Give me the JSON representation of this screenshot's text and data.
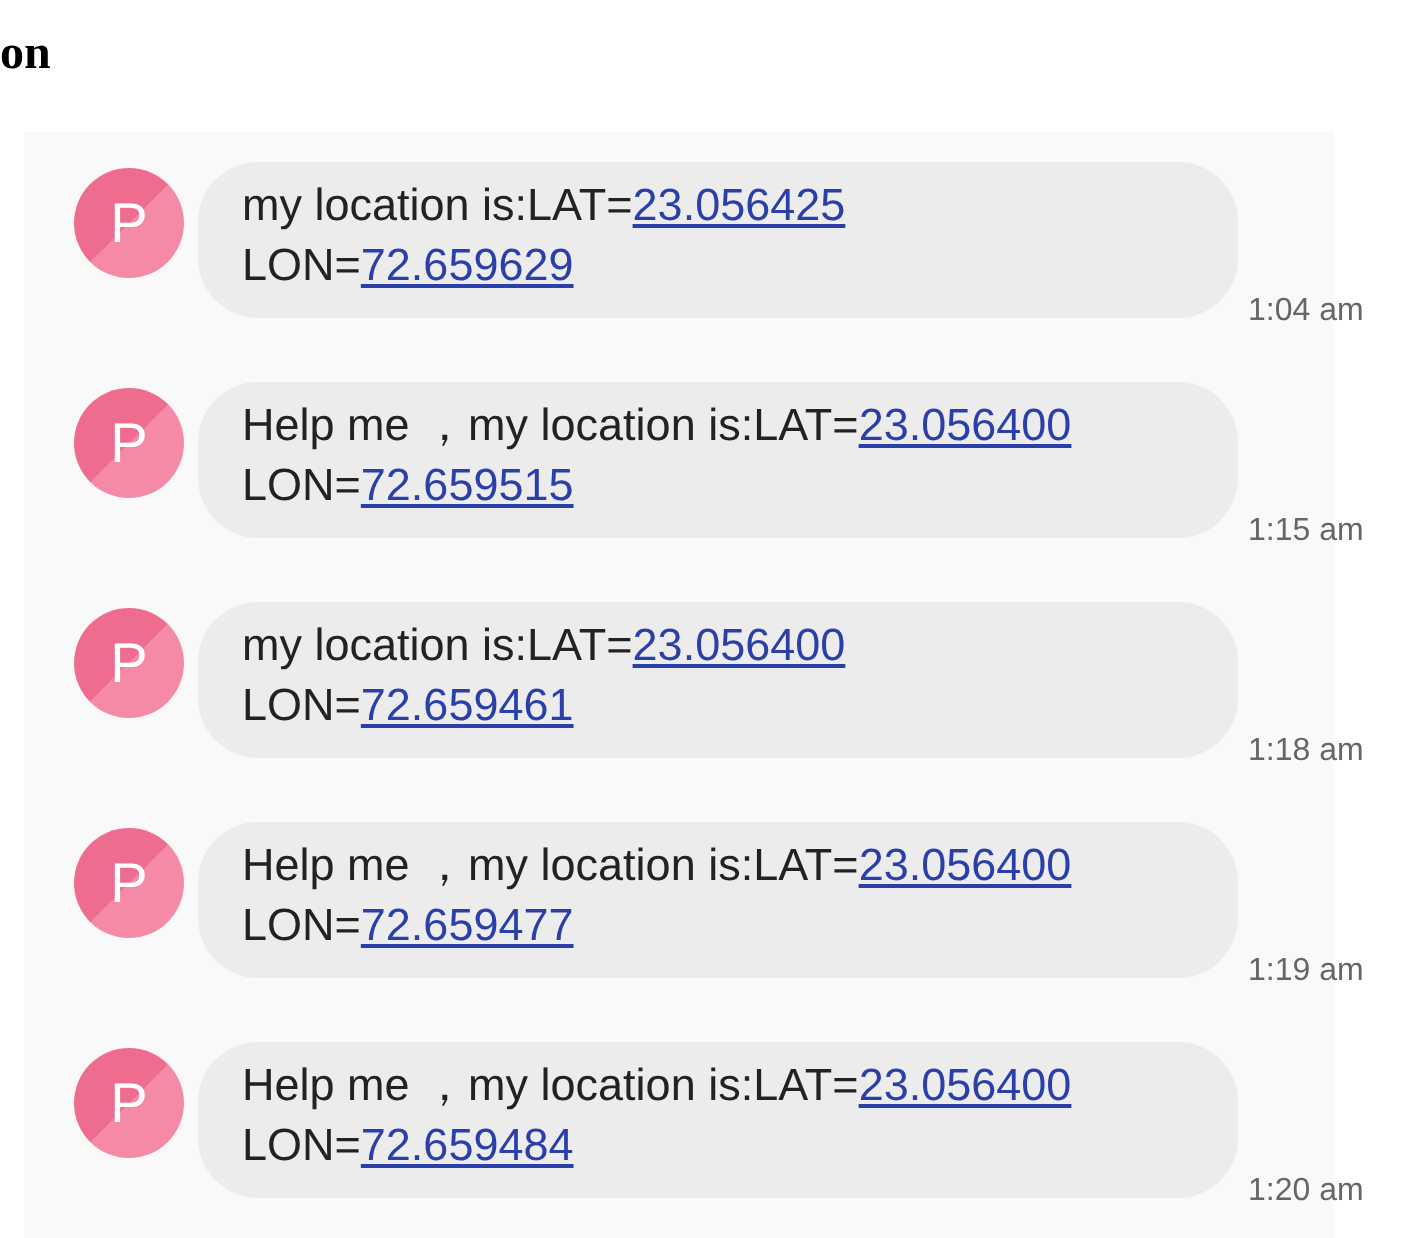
{
  "heading": "on",
  "messages": [
    {
      "avatar": "P",
      "text": "my location is:LAT=",
      "lat": "23.056425",
      "lon_label": "LON=",
      "lon": "72.659629",
      "time": "1:04 am"
    },
    {
      "avatar": "P",
      "text": "Help me ，my location is:LAT=",
      "lat": "23.056400",
      "lon_label": "LON=",
      "lon": "72.659515",
      "time": "1:15 am"
    },
    {
      "avatar": "P",
      "text": "my location is:LAT=",
      "lat": "23.056400",
      "lon_label": "LON=",
      "lon": "72.659461",
      "time": "1:18 am"
    },
    {
      "avatar": "P",
      "text": "Help me ，my location is:LAT=",
      "lat": "23.056400",
      "lon_label": "LON=",
      "lon": "72.659477",
      "time": "1:19 am"
    },
    {
      "avatar": "P",
      "text": "Help me ，my location is:LAT=",
      "lat": "23.056400",
      "lon_label": "LON=",
      "lon": "72.659484",
      "time": "1:20 am"
    }
  ]
}
